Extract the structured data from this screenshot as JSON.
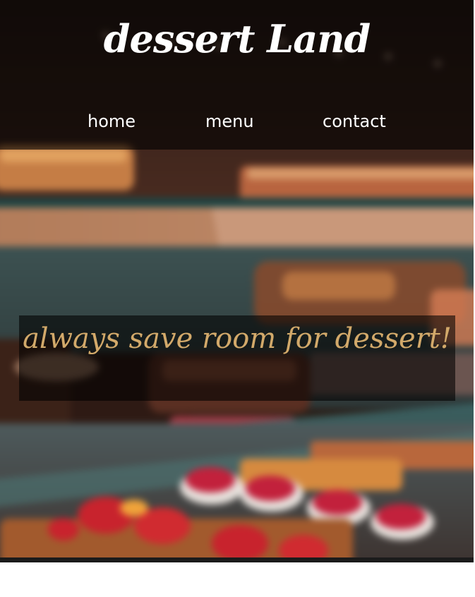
{
  "header": {
    "logo_text": "dessert Land"
  },
  "nav": {
    "items": [
      {
        "label": "home"
      },
      {
        "label": "menu"
      },
      {
        "label": "contact"
      }
    ]
  },
  "hero": {
    "tagline": "always save room for dessert!",
    "tagline_color": "#d2a96a",
    "image_subject": "blurred bakery display case with cakes, tarts and strawberry desserts"
  }
}
